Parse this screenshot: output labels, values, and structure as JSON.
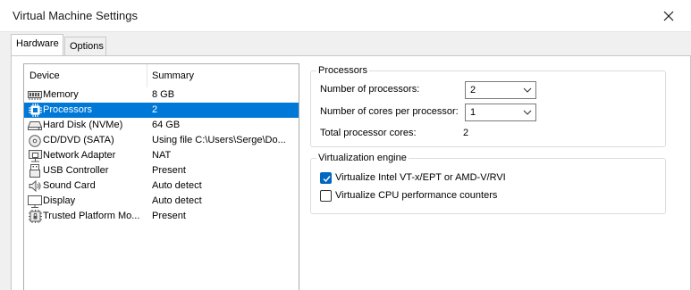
{
  "window": {
    "title": "Virtual Machine Settings"
  },
  "tabs": [
    {
      "label": "Hardware",
      "active": true
    },
    {
      "label": "Options",
      "active": false
    }
  ],
  "device_list": {
    "columns": [
      "Device",
      "Summary"
    ],
    "rows": [
      {
        "icon": "memory-icon",
        "device": "Memory",
        "summary": "8 GB"
      },
      {
        "icon": "processor-icon",
        "device": "Processors",
        "summary": "2",
        "selected": true
      },
      {
        "icon": "hard-disk-icon",
        "device": "Hard Disk (NVMe)",
        "summary": "64 GB"
      },
      {
        "icon": "cd-dvd-icon",
        "device": "CD/DVD (SATA)",
        "summary": "Using file C:\\Users\\Serge\\Do..."
      },
      {
        "icon": "network-adapter-icon",
        "device": "Network Adapter",
        "summary": "NAT"
      },
      {
        "icon": "usb-icon",
        "device": "USB Controller",
        "summary": "Present"
      },
      {
        "icon": "sound-card-icon",
        "device": "Sound Card",
        "summary": "Auto detect"
      },
      {
        "icon": "display-icon",
        "device": "Display",
        "summary": "Auto detect"
      },
      {
        "icon": "tpm-icon",
        "device": "Trusted Platform Mo...",
        "summary": "Present"
      }
    ]
  },
  "processors": {
    "group_title": "Processors",
    "num_processors_label": "Number of processors:",
    "num_processors_value": "2",
    "cores_per_processor_label": "Number of cores per processor:",
    "cores_per_processor_value": "1",
    "total_cores_label": "Total processor cores:",
    "total_cores_value": "2"
  },
  "virtualization": {
    "group_title": "Virtualization engine",
    "options": [
      {
        "label": "Virtualize Intel VT-x/EPT or AMD-V/RVI",
        "checked": true
      },
      {
        "label": "Virtualize CPU performance counters",
        "checked": false
      }
    ]
  },
  "colors": {
    "selection": "#0078d7",
    "checkbox_accent": "#0067c0"
  }
}
